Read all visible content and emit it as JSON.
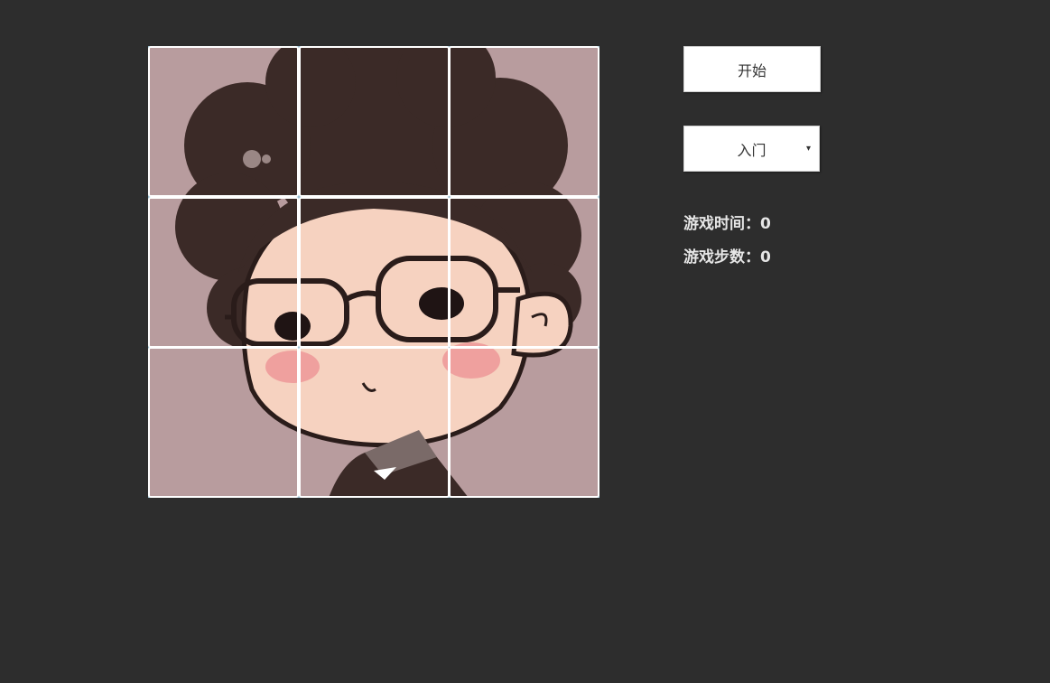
{
  "game": {
    "start_label": "开始",
    "level_selected": "入门",
    "level_arrow": "▾",
    "time_label": "游戏时间：",
    "time_value": "0",
    "steps_label": "游戏步数：",
    "steps_value": "0"
  },
  "puzzle": {
    "grid_size": "3x3",
    "tiles": [
      "1",
      "2",
      "3",
      "4",
      "5",
      "6",
      "7",
      "8",
      "9"
    ]
  },
  "colors": {
    "background": "#2d2d2d",
    "tile_border": "#ffffff",
    "image_bg": "#b89c9e",
    "hair": "#3b2a27",
    "skin": "#f6d2c0",
    "blush": "#ee9a9a"
  }
}
